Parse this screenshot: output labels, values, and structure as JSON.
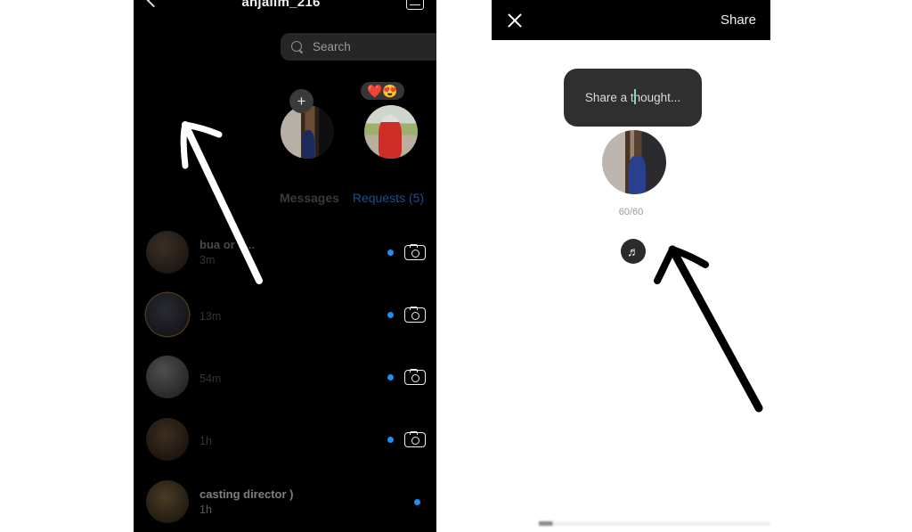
{
  "left_panel": {
    "header": {
      "back_icon": "back-chevron-icon",
      "username": "anjalim_216",
      "compose_icon": "new-message-icon"
    },
    "search": {
      "icon": "search-icon",
      "placeholder": "Search"
    },
    "stories": [
      {
        "label": "your-story",
        "badge": "+",
        "reactions": ""
      },
      {
        "label": "friend-story",
        "badge": "",
        "reactions": "❤️😍"
      }
    ],
    "section": {
      "messages_label": "Messages",
      "requests_label": "Requests (5)",
      "requests_color": "#1a4f8a"
    },
    "conversations": [
      {
        "name": "bua or u...",
        "sub": "3m",
        "unread": true,
        "camera": true
      },
      {
        "name": "",
        "sub": "13m",
        "unread": true,
        "camera": true
      },
      {
        "name": "",
        "sub": "54m",
        "unread": true,
        "camera": true
      },
      {
        "name": "",
        "sub": "1h",
        "unread": true,
        "camera": true
      },
      {
        "name": "casting director )",
        "sub": "1h",
        "unread": true,
        "camera": false
      }
    ],
    "annotation": {
      "type": "hand-drawn-arrow",
      "color": "#ffffff"
    }
  },
  "right_panel": {
    "header": {
      "close_icon": "close-icon",
      "share_label": "Share"
    },
    "composer": {
      "placeholder": "Share a thought...",
      "caret_color": "#7fd6c5"
    },
    "avatar": "user-avatar",
    "char_count": "60/60",
    "music_button": {
      "icon": "music-note-icon",
      "glyph": "♬"
    },
    "annotation": {
      "type": "hand-drawn-arrow",
      "color": "#000000"
    }
  }
}
